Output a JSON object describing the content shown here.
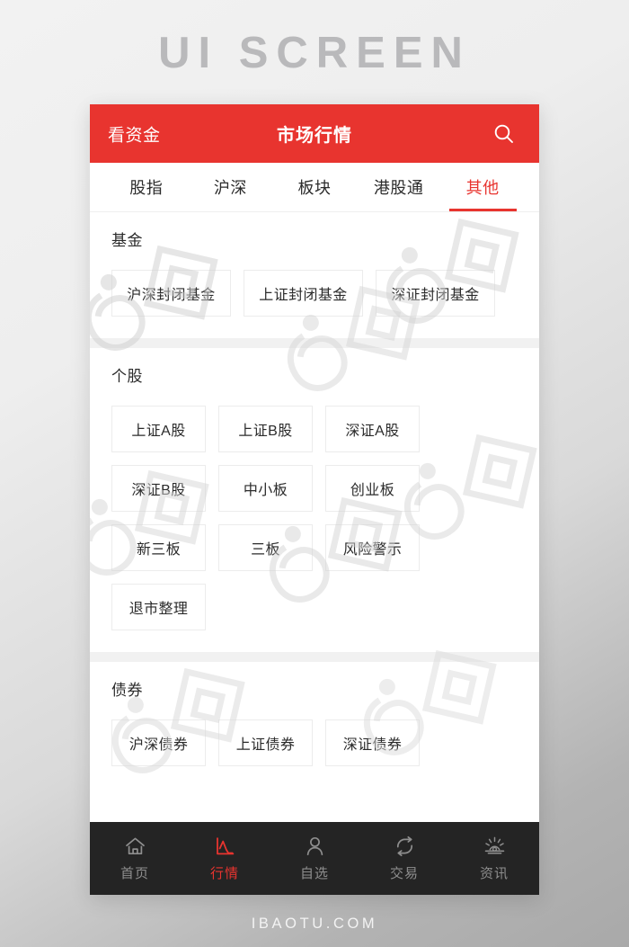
{
  "poster": {
    "title": "UI SCREEN",
    "footer": "IBAOTU.COM"
  },
  "colors": {
    "brand_red": "#e8342f",
    "tabbar_bg": "#242424",
    "divider": "#f1f1f1",
    "chip_border": "#ececec"
  },
  "appbar": {
    "left_label": "看资金",
    "title": "市场行情",
    "search_icon": "search-icon"
  },
  "tabs": [
    {
      "label": "股指",
      "active": false
    },
    {
      "label": "沪深",
      "active": false
    },
    {
      "label": "板块",
      "active": false
    },
    {
      "label": "港股通",
      "active": false
    },
    {
      "label": "其他",
      "active": true
    }
  ],
  "sections": [
    {
      "key": "fund",
      "title": "基金",
      "chips": [
        "沪深封闭基金",
        "上证封闭基金",
        "深证封闭基金"
      ],
      "chip_size": "wide"
    },
    {
      "key": "stock",
      "title": "个股",
      "chips": [
        "上证A股",
        "上证B股",
        "深证A股",
        "深证B股",
        "中小板",
        "创业板",
        "新三板",
        "三板",
        "风险警示",
        "退市整理"
      ],
      "chip_size": "normal"
    },
    {
      "key": "bond",
      "title": "债券",
      "chips": [
        "沪深债券",
        "上证债券",
        "深证债券"
      ],
      "chip_size": "normal"
    }
  ],
  "tabbar": [
    {
      "label": "首页",
      "icon": "home-icon",
      "active": false
    },
    {
      "label": "行情",
      "icon": "chart-icon",
      "active": true
    },
    {
      "label": "自选",
      "icon": "person-icon",
      "active": false
    },
    {
      "label": "交易",
      "icon": "refresh-icon",
      "active": false
    },
    {
      "label": "资讯",
      "icon": "news-eye-icon",
      "active": false
    }
  ]
}
